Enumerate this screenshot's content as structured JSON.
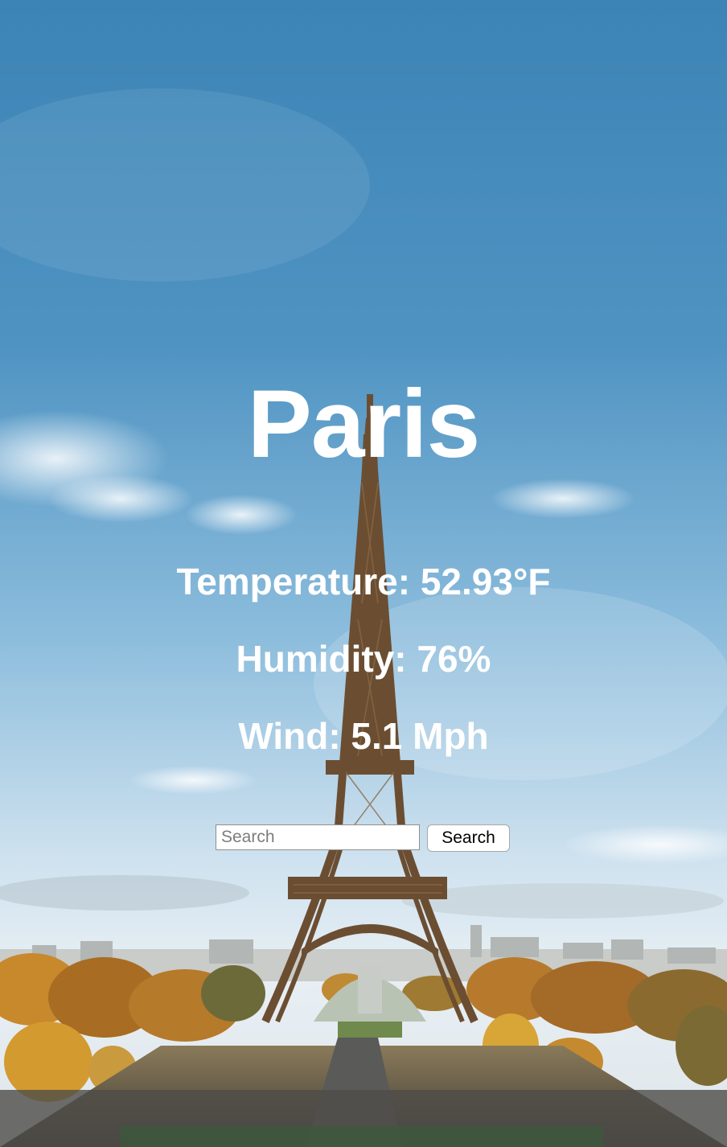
{
  "weather": {
    "city": "Paris",
    "temperature": "Temperature: 52.93°F",
    "humidity": "Humidity: 76%",
    "wind": "Wind: 5.1 Mph"
  },
  "search": {
    "placeholder": "Search",
    "button_label": "Search"
  },
  "colors": {
    "text": "#ffffff",
    "sky_top": "#3f86b8",
    "sky_bottom": "#e6eef3",
    "tower": "#6b4e32"
  }
}
